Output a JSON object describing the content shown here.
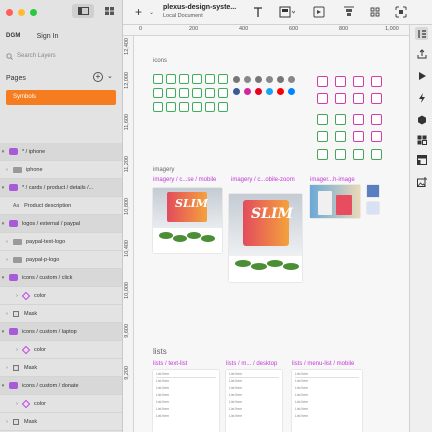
{
  "window": {
    "traffic_lights": [
      "close",
      "minimize",
      "zoom"
    ],
    "view_toggle": [
      "sidebar-view",
      "grid-view"
    ]
  },
  "sidebar": {
    "brand": "DGM",
    "sign_in": "Sign In",
    "search_placeholder": "Search Layers",
    "pages_label": "Pages",
    "pages": [
      {
        "label": "Symbols",
        "selected": true
      }
    ],
    "layers": [
      {
        "label": "* / iphone",
        "type": "symbol",
        "level": 0
      },
      {
        "label": "iphone",
        "type": "folder",
        "level": 1
      },
      {
        "label": "* / cards / product / details /...",
        "type": "symbol",
        "level": 0
      },
      {
        "label": "Product description",
        "type": "text",
        "level": 1
      },
      {
        "label": "logos / external / paypal",
        "type": "symbol",
        "level": 0
      },
      {
        "label": "paypal-text-logo",
        "type": "folder",
        "level": 1
      },
      {
        "label": "paypal-p-logo",
        "type": "folder",
        "level": 1
      },
      {
        "label": "icons / custom / click",
        "type": "symbol",
        "level": 0
      },
      {
        "label": "color",
        "type": "color",
        "level": 2
      },
      {
        "label": "Mask",
        "type": "mask",
        "level": 1
      },
      {
        "label": "icons / custom / laptop",
        "type": "symbol",
        "level": 0
      },
      {
        "label": "color",
        "type": "color",
        "level": 2
      },
      {
        "label": "Mask",
        "type": "mask",
        "level": 1
      },
      {
        "label": "icons / custom / donate",
        "type": "symbol",
        "level": 0
      },
      {
        "label": "color",
        "type": "color",
        "level": 2
      },
      {
        "label": "Mask",
        "type": "mask",
        "level": 1
      }
    ]
  },
  "toolbar": {
    "doc_title": "plexus-design-syste...",
    "doc_subtitle": "Local Document",
    "icons": [
      "plus-icon",
      "text-tool-icon",
      "shape-tool-icon",
      "align-icon",
      "distribute-icon",
      "component-icon",
      "scale-icon"
    ]
  },
  "rulers": {
    "top": [
      "0",
      "200",
      "400",
      "600",
      "800",
      "1,000"
    ],
    "left": [
      "12,400",
      "12,000",
      "11,600",
      "11,200",
      "10,800",
      "10,400",
      "10,000",
      "9,600",
      "9,200"
    ]
  },
  "canvas": {
    "sections": {
      "icons": "icons",
      "imagery": "imagery",
      "lists": "lists"
    },
    "frames": [
      {
        "label": "imagery / c...se / mobile"
      },
      {
        "label": "imagery / c...obile-zoom"
      },
      {
        "label": "imager...h-image"
      },
      {
        "label": "lists / text-list"
      },
      {
        "label": "lists / m... / desktop"
      },
      {
        "label": "lists / menu-list / mobile"
      }
    ],
    "product_text": "SLIM",
    "list_items": [
      "List Item",
      "List Item",
      "List Item",
      "List Item",
      "List Item",
      "List Item",
      "List Item"
    ],
    "accent_color": "#f57c1f",
    "frame_label_color": "#c23ad6"
  },
  "right_rail": {
    "icons": [
      "inspector-icon",
      "play-icon",
      "lightning-icon",
      "component-hex-icon",
      "grid-icon",
      "layout-icon",
      "add-image-icon"
    ]
  }
}
